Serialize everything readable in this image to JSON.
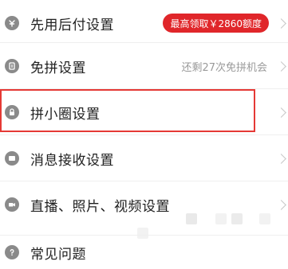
{
  "settings": {
    "items": [
      {
        "label": "先用后付设置",
        "icon": "pay-later-icon",
        "badge": "最高领取￥2860额度"
      },
      {
        "label": "免拼设置",
        "icon": "no-group-icon",
        "right_text": "还剩27次免拼机会"
      },
      {
        "label": "拼小圈设置",
        "icon": "lock-icon"
      },
      {
        "label": "消息接收设置",
        "icon": "message-icon"
      },
      {
        "label": "直播、照片、视频设置",
        "icon": "video-icon"
      },
      {
        "label": "常见问题",
        "icon": "question-icon"
      }
    ]
  },
  "colors": {
    "badge_bg": "#e0262a",
    "highlight_border": "#e53935",
    "icon_gray": "#8a8a8a",
    "secondary_text": "#9a9a9a"
  }
}
